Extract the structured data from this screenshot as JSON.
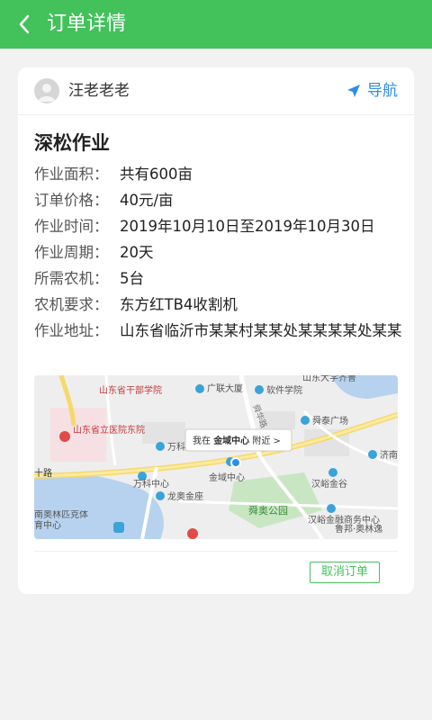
{
  "header": {
    "title": "订单详情"
  },
  "user": {
    "name": "汪老老老",
    "nav_label": "导航"
  },
  "job": {
    "title": "深松作业",
    "rows": [
      {
        "label": "作业面积：",
        "value": "共有600亩"
      },
      {
        "label": "订单价格：",
        "value": "40元/亩"
      },
      {
        "label": "作业时间：",
        "value": "2019年10月10日至2019年10月30日"
      },
      {
        "label": "作业周期：",
        "value": "20天"
      },
      {
        "label": "所需农机：",
        "value": "5台"
      },
      {
        "label": "农机要求：",
        "value": "东方红TB4收割机"
      },
      {
        "label": "作业地址：",
        "value": "山东省临沂市某某村某某处某某某某处某某"
      }
    ]
  },
  "map": {
    "poi": {
      "sd_cadre": "山东省干部学院",
      "guanglian": "广联大厦",
      "sd_univ": "山东大学齐鲁",
      "software": "软件学院",
      "shunhua": "舜华路",
      "shuntai": "舜泰广场",
      "hospital": "山东省立医院东院",
      "wanke": "万科",
      "callout_prefix": "我在",
      "callout_place": "金域中心",
      "callout_suffix": "附近 >",
      "jinan": "济南",
      "shilu": "十路",
      "wanke_center": "万科中心",
      "jinyu_center": "金域中心",
      "hanyu": "汉峪金谷",
      "longao": "龙奥金座",
      "olympic": "南奥林匹克体育中心",
      "shunao": "舜奥公园",
      "hanyu_finance": "汉峪金融商务中心",
      "lubang": "鲁邦·奥林逸"
    }
  },
  "footer": {
    "cancel_label": "取消订单"
  },
  "colors": {
    "primary": "#43c15b",
    "link": "#2c8de8"
  }
}
